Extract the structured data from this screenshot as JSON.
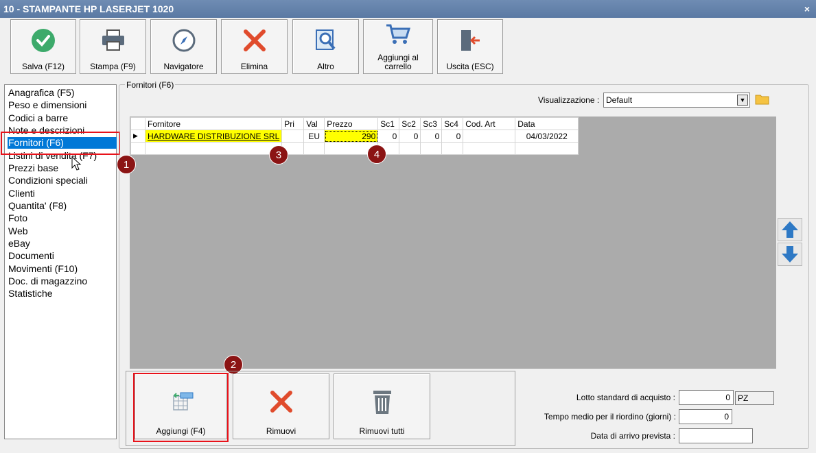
{
  "window": {
    "title": "10 - STAMPANTE HP LASERJET 1020",
    "close_symbol": "×"
  },
  "toolbar": {
    "save": "Salva (F12)",
    "print": "Stampa (F9)",
    "navigator": "Navigatore",
    "delete": "Elimina",
    "other": "Altro",
    "add_cart": "Aggiungi al carrello",
    "exit": "Uscita (ESC)"
  },
  "sidebar": {
    "items": [
      "Anagrafica (F5)",
      "Peso e dimensioni",
      "Codici a barre",
      "Note e descrizioni",
      "Fornitori (F6)",
      "Listini di vendita (F7)",
      "Prezzi base",
      "Condizioni speciali",
      "Clienti",
      "Quantita' (F8)",
      "Foto",
      "Web",
      "eBay",
      "Documenti",
      "Movimenti (F10)",
      "Doc. di magazzino",
      "Statistiche"
    ],
    "selected": "Fornitori (F6)"
  },
  "group": {
    "title": "Fornitori (F6)"
  },
  "view": {
    "label": "Visualizzazione :",
    "value": "Default"
  },
  "grid": {
    "columns": [
      "Fornitore",
      "Pri",
      "Val",
      "Prezzo",
      "Sc1",
      "Sc2",
      "Sc3",
      "Sc4",
      "Cod. Art",
      "Data"
    ],
    "row": {
      "fornitore": "HARDWARE DISTRIBUZIONE SRL",
      "pri": "",
      "val": "EU",
      "prezzo": "290",
      "sc1": "0",
      "sc2": "0",
      "sc3": "0",
      "sc4": "0",
      "cod_art": "",
      "data": "04/03/2022"
    }
  },
  "badges": {
    "b1": "1",
    "b2": "2",
    "b3": "3",
    "b4": "4"
  },
  "bottom": {
    "add": "Aggiungi (F4)",
    "remove": "Rimuovi",
    "remove_all": "Rimuovi tutti"
  },
  "fields": {
    "lot_label": "Lotto standard di acquisto :",
    "lot_value": "0",
    "lot_unit": "PZ",
    "reorder_label": "Tempo medio per il riordino (giorni) :",
    "reorder_value": "0",
    "arrival_label": "Data di arrivo prevista :",
    "arrival_value": ""
  },
  "colors": {
    "accent_red": "#e8121a",
    "badge": "#8b1414",
    "selection": "#0078d7",
    "highlight": "#ffff00"
  }
}
